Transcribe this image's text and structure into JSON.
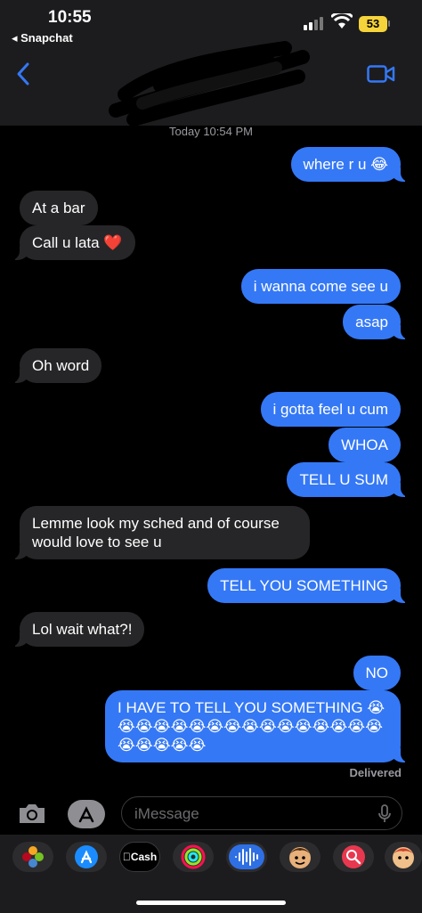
{
  "status_bar": {
    "time": "10:55",
    "back_app": "◂ Snapchat",
    "battery": "53"
  },
  "header": {
    "back_icon": "chevron-left-icon",
    "video_icon": "video-camera-icon",
    "accent": "#3478f6"
  },
  "chat": {
    "timestamp": "Today 10:54 PM",
    "messages": [
      {
        "side": "sent",
        "text": "where r u 😂"
      },
      {
        "side": "received",
        "text": "At a bar"
      },
      {
        "side": "received",
        "text": "Call u lata ❤️"
      },
      {
        "side": "sent",
        "text": "i wanna come see u"
      },
      {
        "side": "sent",
        "text": "asap"
      },
      {
        "side": "received",
        "text": "Oh word"
      },
      {
        "side": "sent",
        "text": "i gotta feel u cum"
      },
      {
        "side": "sent",
        "text": "WHOA"
      },
      {
        "side": "sent",
        "text": "TELL U SUM"
      },
      {
        "side": "received",
        "text": "Lemme look my sched and of course would love to see u"
      },
      {
        "side": "sent",
        "text": "TELL YOU SOMETHING"
      },
      {
        "side": "received",
        "text": "Lol wait what?!"
      },
      {
        "side": "sent",
        "text": "NO"
      },
      {
        "side": "sent",
        "text": "I HAVE TO TELL YOU SOMETHING 😭😭😭😭😭😭😭😭😭😭😭😭😭😭😭😭😭😭😭😭😭"
      }
    ],
    "status": "Delivered"
  },
  "input": {
    "placeholder": "iMessage"
  },
  "drawer": {
    "cash_label": "Cash"
  },
  "colors": {
    "sent_bubble": "#3478f6",
    "received_bubble": "#262628",
    "background": "#000000"
  }
}
